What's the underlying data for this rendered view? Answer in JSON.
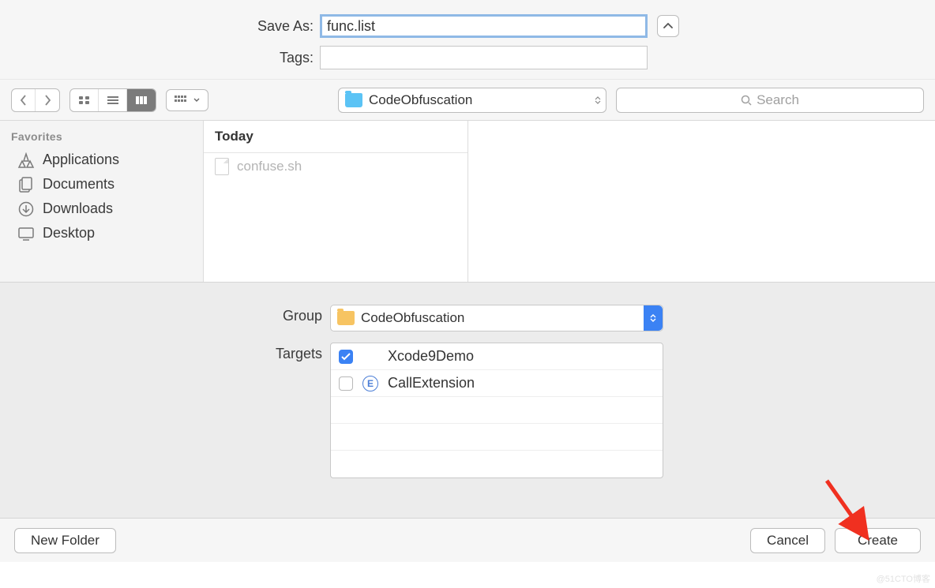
{
  "saveAs": {
    "label": "Save As:",
    "value": "func.list"
  },
  "tags": {
    "label": "Tags:",
    "value": ""
  },
  "toolbar": {
    "pathName": "CodeObfuscation",
    "searchPlaceholder": "Search"
  },
  "sidebar": {
    "heading": "Favorites",
    "items": [
      {
        "label": "Applications"
      },
      {
        "label": "Documents"
      },
      {
        "label": "Downloads"
      },
      {
        "label": "Desktop"
      }
    ]
  },
  "column": {
    "header": "Today",
    "files": [
      {
        "name": "confuse.sh"
      }
    ]
  },
  "group": {
    "label": "Group",
    "value": "CodeObfuscation"
  },
  "targets": {
    "label": "Targets",
    "items": [
      {
        "checked": true,
        "name": "Xcode9Demo",
        "iconType": "app"
      },
      {
        "checked": false,
        "name": "CallExtension",
        "iconType": "ext"
      }
    ]
  },
  "buttons": {
    "newFolder": "New Folder",
    "cancel": "Cancel",
    "create": "Create"
  },
  "watermark": "@51CTO博客"
}
